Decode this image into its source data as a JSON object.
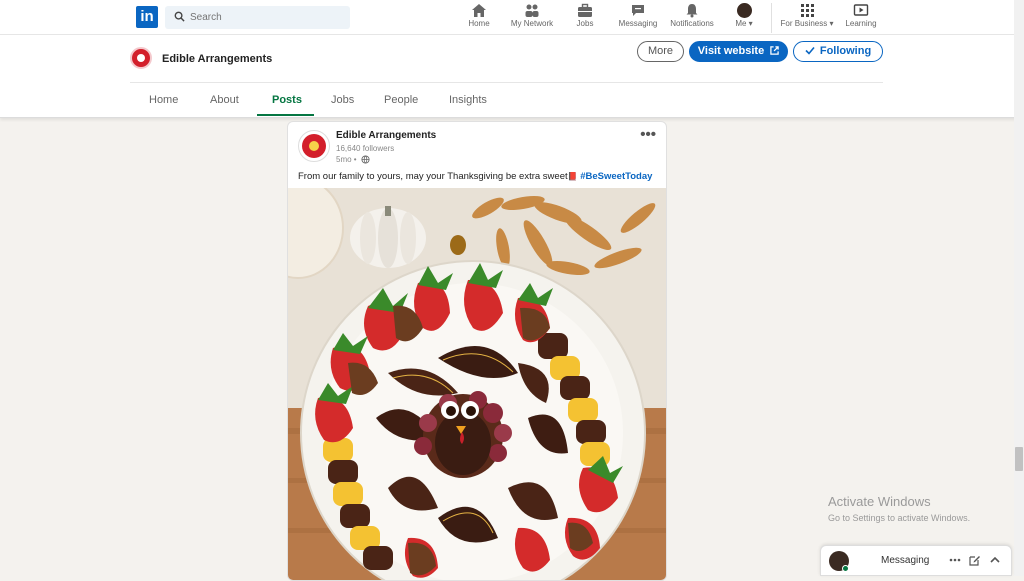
{
  "nav": {
    "logo": "in",
    "search_placeholder": "Search",
    "items": [
      {
        "label": "Home",
        "icon": "home-icon"
      },
      {
        "label": "My Network",
        "icon": "network-icon"
      },
      {
        "label": "Jobs",
        "icon": "briefcase-icon"
      },
      {
        "label": "Messaging",
        "icon": "messaging-icon"
      },
      {
        "label": "Notifications",
        "icon": "bell-icon"
      },
      {
        "label": "Me ▾",
        "icon": "avatar"
      },
      {
        "label": "For Business ▾",
        "icon": "grid-icon"
      },
      {
        "label": "Learning",
        "icon": "learning-icon"
      }
    ]
  },
  "company": {
    "name": "Edible Arrangements",
    "buttons": {
      "more": "More",
      "visit": "Visit website",
      "following": "Following"
    },
    "tabs": [
      "Home",
      "About",
      "Posts",
      "Jobs",
      "People",
      "Insights"
    ],
    "active_tab": "Posts"
  },
  "post": {
    "author": "Edible Arrangements",
    "followers": "16,640 followers",
    "time": "5mo •",
    "menu": "•••",
    "text": "From our family to yours, may your Thanksgiving be extra sweet",
    "emoji": "📕",
    "hashtag": "#BeSweetToday"
  },
  "watermark": {
    "title": "Activate Windows",
    "subtitle": "Go to Settings to activate Windows."
  },
  "messaging": {
    "label": "Messaging"
  },
  "colors": {
    "brand": "#0a66c2",
    "active_tab": "#057642",
    "company_red": "#d31f2b"
  }
}
